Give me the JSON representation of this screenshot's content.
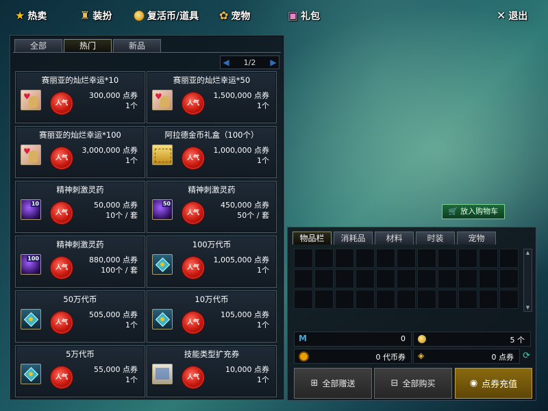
{
  "topnav": {
    "hot": "热卖",
    "outfit": "装扮",
    "revival": "复活币/道具",
    "pets": "宠物",
    "gift": "礼包",
    "exit": "退出"
  },
  "tabs": [
    "全部",
    "热门",
    "新品"
  ],
  "active_tab": "热门",
  "pager": {
    "current": "1/2",
    "prev_icon": "prev-arrow-icon",
    "next_icon": "next-arrow-icon"
  },
  "hot_badge": "人气",
  "products": [
    {
      "name": "赛丽亚的灿烂幸运*10",
      "price": "300,000 点券",
      "qty": "1个",
      "icon": "ticket-icon"
    },
    {
      "name": "赛丽亚的灿烂幸运*50",
      "price": "1,500,000 点券",
      "qty": "1个",
      "icon": "ticket-icon"
    },
    {
      "name": "赛丽亚的灿烂幸运*100",
      "price": "3,000,000 点券",
      "qty": "1个",
      "icon": "ticket-icon"
    },
    {
      "name": "阿拉德金币礼盒（100个）",
      "price": "1,000,000 点券",
      "qty": "1个",
      "icon": "gold-box-icon"
    },
    {
      "name": "精神刺激灵药",
      "price": "50,000 点券",
      "qty": "10个 / 套",
      "icon": "potion-icon",
      "badge": "10"
    },
    {
      "name": "精神刺激灵药",
      "price": "450,000 点券",
      "qty": "50个 / 套",
      "icon": "potion-icon",
      "badge": "50"
    },
    {
      "name": "精神刺激灵药",
      "price": "880,000 点券",
      "qty": "100个 / 套",
      "icon": "potion-icon",
      "badge": "100"
    },
    {
      "name": "100万代币",
      "price": "1,005,000 点券",
      "qty": "1个",
      "icon": "voucher-icon"
    },
    {
      "name": "50万代币",
      "price": "505,000 点券",
      "qty": "1个",
      "icon": "voucher-icon"
    },
    {
      "name": "10万代币",
      "price": "105,000 点券",
      "qty": "1个",
      "icon": "voucher-icon"
    },
    {
      "name": "5万代币",
      "price": "55,000 点券",
      "qty": "1个",
      "icon": "voucher-icon"
    },
    {
      "name": "技能类型扩充券",
      "price": "10,000 点券",
      "qty": "1个",
      "icon": "scroll-icon"
    }
  ],
  "cart_button": "放入购物车",
  "inventory": {
    "tabs": [
      "物品栏",
      "消耗品",
      "材料",
      "时装",
      "宠物"
    ],
    "active_tab": "物品栏",
    "slots": 33
  },
  "balances": {
    "mileage": "0",
    "gold_coins": "5 个",
    "tokens": "0 代币券",
    "points": "0 点券"
  },
  "actions": {
    "gift_all": "全部赠送",
    "buy_all": "全部购买",
    "recharge": "点券充值"
  }
}
